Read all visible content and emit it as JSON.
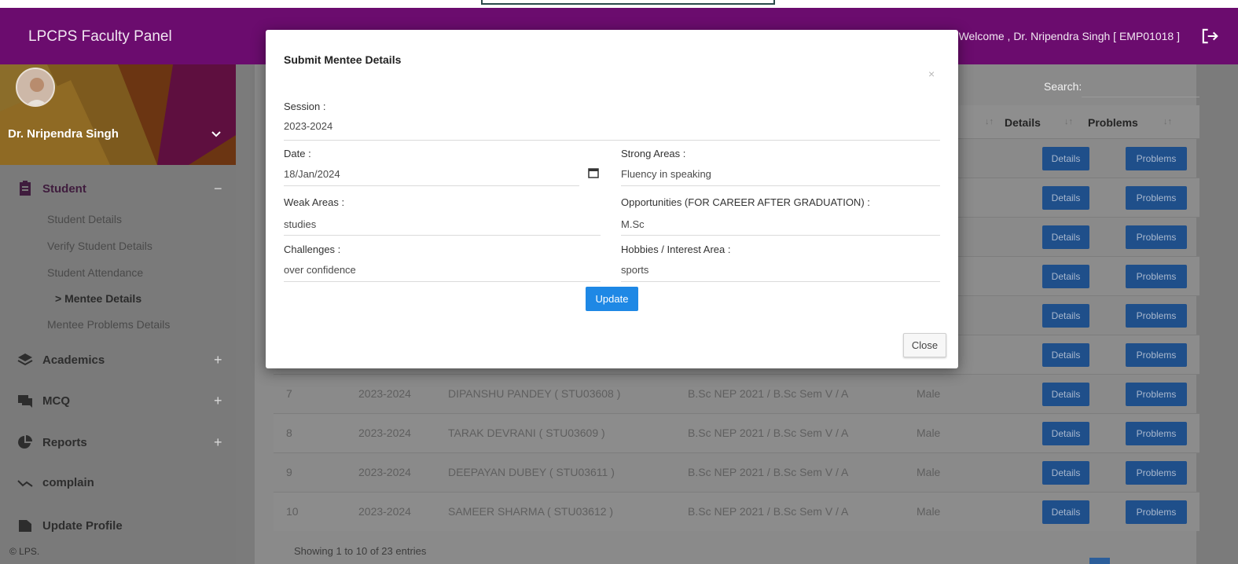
{
  "header": {
    "brand": "LPCPS Faculty Panel",
    "welcome": "Welcome , Dr. Nripendra Singh [ EMP01018 ]",
    "logout_icon": "logout-icon"
  },
  "sidebar": {
    "profile_name": "Dr. Nripendra Singh",
    "sections": [
      {
        "label": "Student",
        "sign": "−",
        "icon": "clipboard-icon"
      },
      {
        "label": "Academics",
        "sign": "+",
        "icon": "layers-icon"
      },
      {
        "label": "MCQ",
        "sign": "+",
        "icon": "chat-icon"
      },
      {
        "label": "Reports",
        "sign": "+",
        "icon": "pie-chart-icon"
      },
      {
        "label": "complain",
        "sign": "",
        "icon": "trend-icon"
      },
      {
        "label": "Update Profile",
        "sign": "",
        "icon": "folder-icon"
      }
    ],
    "student_items": [
      "Student Details",
      "Verify Student Details",
      "Student Attendance",
      "> Mentee Details",
      "Mentee Problems Details"
    ],
    "copyright": "© LPS."
  },
  "table": {
    "search_label": "Search:",
    "headers": {
      "details": "Details",
      "problems": "Problems"
    },
    "button_labels": {
      "details": "Details",
      "problems": "Problems"
    },
    "rows": [
      {
        "no": "7",
        "session": "2023-2024",
        "name": "DIPANSHU PANDEY ( STU03608 )",
        "class": "B.Sc NEP 2021 / B.Sc Sem V / A",
        "gender": "Male"
      },
      {
        "no": "8",
        "session": "2023-2024",
        "name": "TARAK DEVRANI ( STU03609 )",
        "class": "B.Sc NEP 2021 / B.Sc Sem V / A",
        "gender": "Male"
      },
      {
        "no": "9",
        "session": "2023-2024",
        "name": "DEEPAYAN DUBEY ( STU03611 )",
        "class": "B.Sc NEP 2021 / B.Sc Sem V / A",
        "gender": "Male"
      },
      {
        "no": "10",
        "session": "2023-2024",
        "name": "SAMEER SHARMA ( STU03612 )",
        "class": "B.Sc NEP 2021 / B.Sc Sem V / A",
        "gender": "Male"
      }
    ],
    "showing": "Showing 1 to 10 of 23 entries"
  },
  "modal": {
    "title": "Submit Mentee Details",
    "close_x": "×",
    "session_label": "Session :",
    "session_value": "2023-2024",
    "date_label": "Date :",
    "date_value": "18/Jan/2024",
    "strong_label": "Strong Areas :",
    "strong_value": "Fluency in speaking",
    "weak_label": "Weak Areas :",
    "weak_value": "studies",
    "opp_label": "Opportunities (FOR CAREER AFTER GRADUATION) :",
    "opp_value": "M.Sc",
    "challenges_label": "Challenges :",
    "challenges_value": "over confidence",
    "hobbies_label": "Hobbies / Interest Area :",
    "hobbies_value": "sports",
    "update_label": "Update",
    "close_label": "Close"
  }
}
